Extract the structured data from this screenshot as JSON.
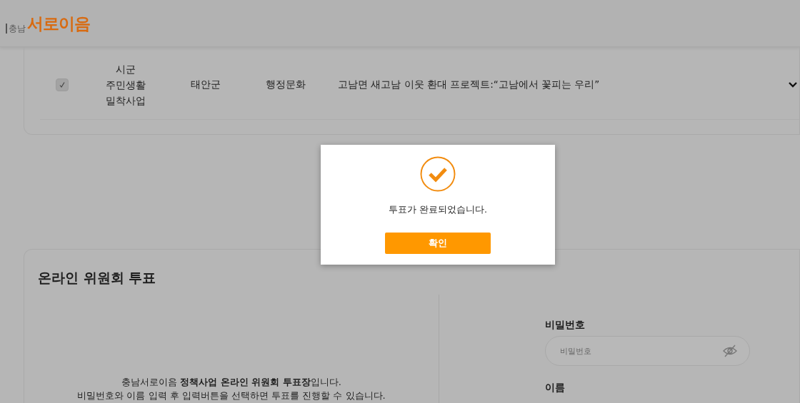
{
  "header": {
    "logo_prefix": "충남",
    "logo_name": "서로이음"
  },
  "project_row": {
    "checked": true,
    "category": "시군 주민생활 밀착사업",
    "region": "태안군",
    "field": "행정문화",
    "title": "고남면 새고남 이웃 환대 프로젝트:“고남에서 꽃피는 우리”",
    "expanded": false
  },
  "vote_section": {
    "title": "온라인 위원회 투표",
    "intro": [
      "충남서로이음 **정책사업 온라인 위원회 투표장**입니다.",
      "비밀번호와 이름 입력 후 입력버튼을 선택하면 투표를 진행할 수 있습니다."
    ],
    "fields": [
      {
        "label": "비밀번호",
        "placeholder": "비밀번호",
        "kind": "password"
      },
      {
        "label": "이름"
      }
    ]
  },
  "dialog": {
    "message": "투표가 완료되었습니다.",
    "button": "확인"
  }
}
